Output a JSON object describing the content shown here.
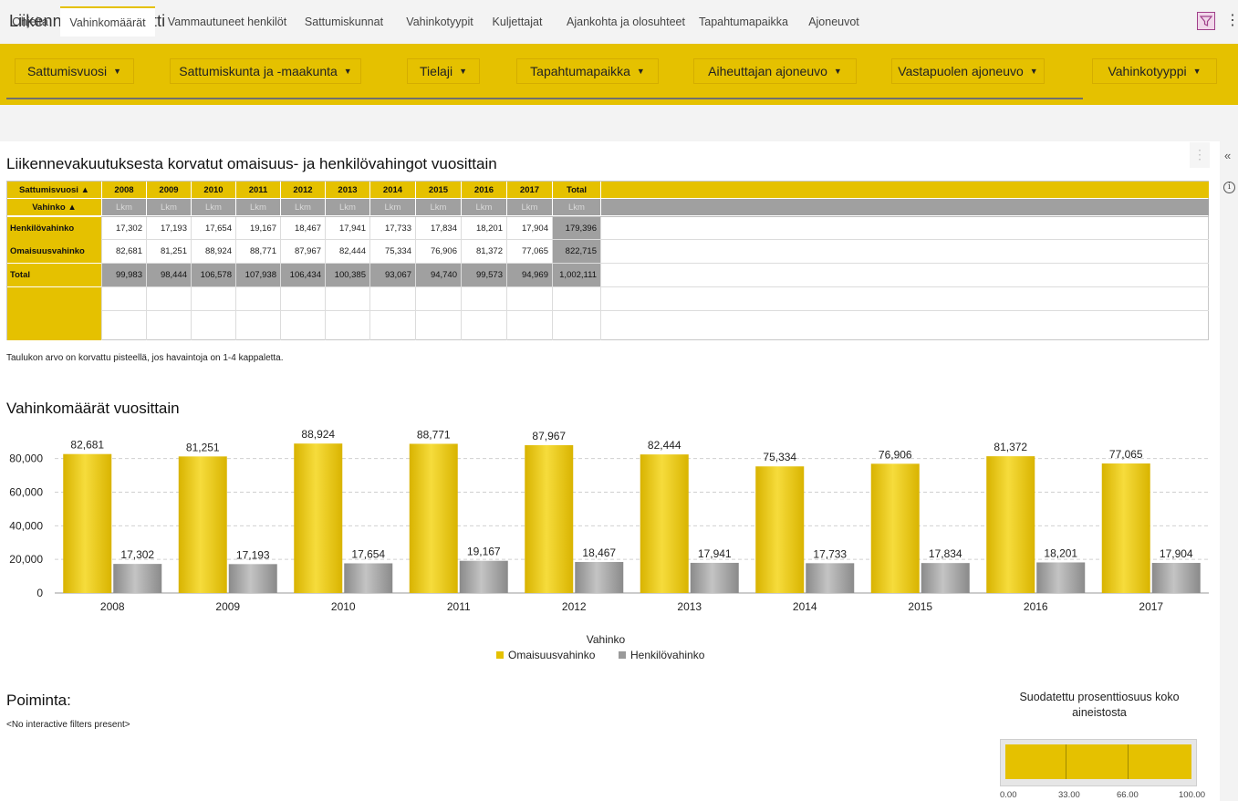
{
  "app": {
    "title": "Liikennevahinkoportti"
  },
  "filters": [
    {
      "label": "Sattumisvuosi"
    },
    {
      "label": "Sattumiskunta ja -maakunta"
    },
    {
      "label": "Tielaji"
    },
    {
      "label": "Tapahtumapaikka"
    },
    {
      "label": "Aiheuttajan ajoneuvo"
    },
    {
      "label": "Vastapuolen ajoneuvo"
    },
    {
      "label": "Vahinkotyyppi"
    }
  ],
  "tabs": [
    {
      "label": "Ohjeita"
    },
    {
      "label": "Vahinkomäärät",
      "active": true
    },
    {
      "label": "Vammautuneet henkilöt"
    },
    {
      "label": "Sattumiskunnat"
    },
    {
      "label": "Vahinkotyypit"
    },
    {
      "label": "Kuljettajat"
    },
    {
      "label": "Ajankohta ja olosuhteet"
    },
    {
      "label": "Tapahtumapaikka"
    },
    {
      "label": "Ajoneuvot"
    }
  ],
  "table": {
    "title": "Liikennevakuutuksesta korvatut omaisuus- ja henkilövahingot vuosittain",
    "row_header_1": "Sattumisvuosi ▲",
    "row_header_2": "Vahinko ▲",
    "columns": [
      "2008",
      "2009",
      "2010",
      "2011",
      "2012",
      "2013",
      "2014",
      "2015",
      "2016",
      "2017",
      "Total"
    ],
    "unit": "Lkm",
    "rows": [
      {
        "label": "Henkilövahinko",
        "values": [
          "17,302",
          "17,193",
          "17,654",
          "19,167",
          "18,467",
          "17,941",
          "17,733",
          "17,834",
          "18,201",
          "17,904",
          "179,396"
        ]
      },
      {
        "label": "Omaisuusvahinko",
        "values": [
          "82,681",
          "81,251",
          "88,924",
          "88,771",
          "87,967",
          "82,444",
          "75,334",
          "76,906",
          "81,372",
          "77,065",
          "822,715"
        ]
      },
      {
        "label": "Total",
        "values": [
          "99,983",
          "98,444",
          "106,578",
          "107,938",
          "106,434",
          "100,385",
          "93,067",
          "94,740",
          "99,573",
          "94,969",
          "1,002,111"
        ]
      }
    ],
    "note": "Taulukon arvo on korvattu pisteellä, jos havaintoja on 1-4 kappaletta."
  },
  "chart_section": {
    "title": "Vahinkomäärät vuosittain"
  },
  "chart_data": {
    "type": "bar",
    "title": "Vahinkomäärät vuosittain",
    "categories": [
      "2008",
      "2009",
      "2010",
      "2011",
      "2012",
      "2013",
      "2014",
      "2015",
      "2016",
      "2017"
    ],
    "series": [
      {
        "name": "Omaisuusvahinko",
        "values": [
          82681,
          81251,
          88924,
          88771,
          87967,
          82444,
          75334,
          76906,
          81372,
          77065
        ],
        "labels": [
          "82,681",
          "81,251",
          "88,924",
          "88,771",
          "87,967",
          "82,444",
          "75,334",
          "76,906",
          "81,372",
          "77,065"
        ],
        "color": "#e5c100"
      },
      {
        "name": "Henkilövahinko",
        "values": [
          17302,
          17193,
          17654,
          19167,
          18467,
          17941,
          17733,
          17834,
          18201,
          17904
        ],
        "labels": [
          "17,302",
          "17,193",
          "17,654",
          "19,167",
          "18,467",
          "17,941",
          "17,733",
          "17,834",
          "18,201",
          "17,904"
        ],
        "color": "#9a9a9a"
      }
    ],
    "yticks": [
      0,
      20000,
      40000,
      60000,
      80000
    ],
    "ytick_labels": [
      "0",
      "20,000",
      "40,000",
      "60,000",
      "80,000"
    ],
    "ylim": [
      0,
      95000
    ],
    "legend_title": "Vahinko",
    "legend_position": "bottom-center",
    "grid": true
  },
  "selection": {
    "title": "Poiminta:",
    "empty_text": "<No interactive filters present>"
  },
  "percent_widget": {
    "title_line1": "Suodatettu prosenttiosuus koko",
    "title_line2": "aineistosta",
    "value": 100,
    "ticks": [
      "0.00",
      "33.00",
      "66.00",
      "100.00"
    ]
  },
  "colors": {
    "accent": "#e5c100",
    "secondary": "#9a9a9a",
    "filter_active": "#a0408a"
  },
  "icons": {
    "filter": "filter-icon",
    "menu": "kebab-menu-icon",
    "collapse": "double-chevron-left-icon",
    "info": "info-icon"
  }
}
